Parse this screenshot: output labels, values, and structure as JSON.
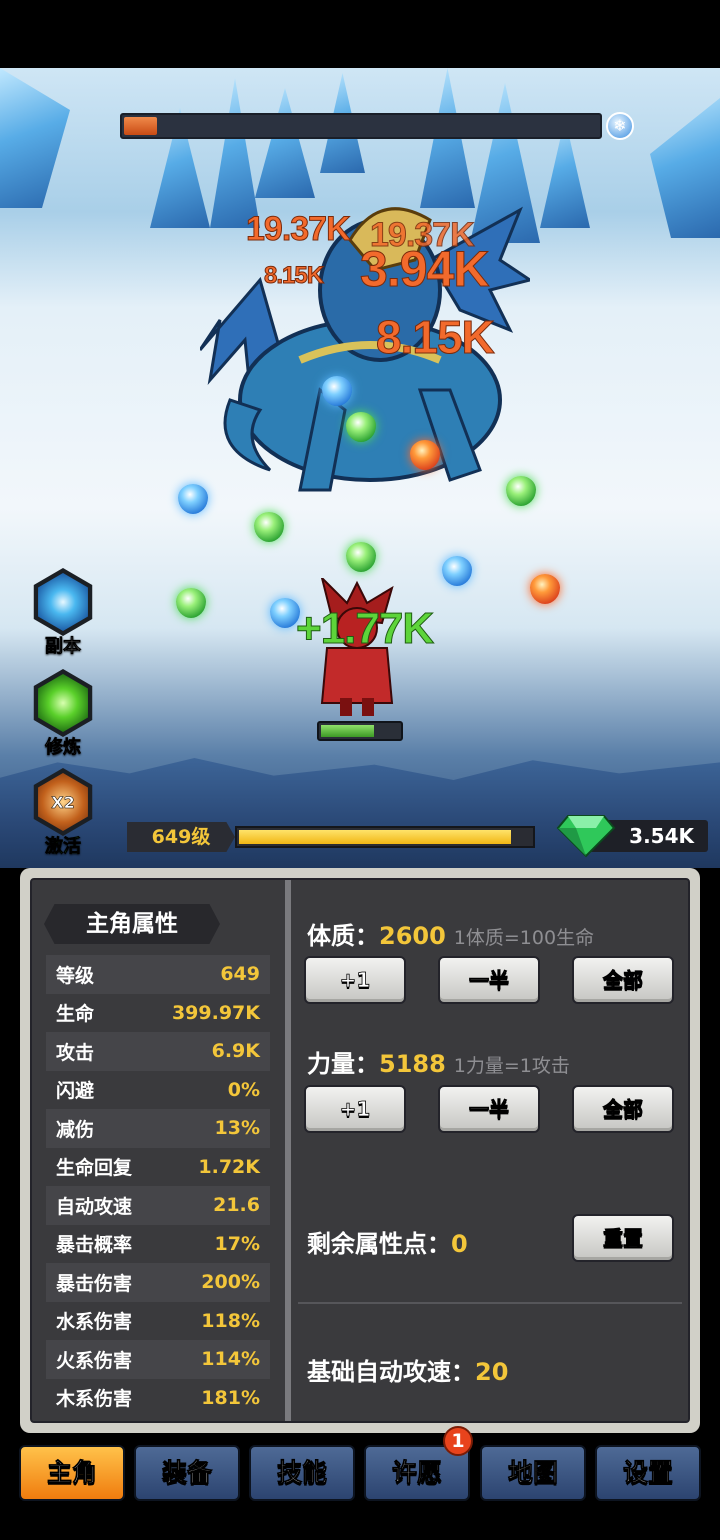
{
  "battle": {
    "boss_hp_fraction": 0.07,
    "boss_element_icon": "snowflake-icon",
    "damage_numbers": [
      "19.37K",
      "19.37K",
      "8.15K",
      "3.94K",
      "8.15K"
    ],
    "heal_number": "+1.77K",
    "hero_hp_fraction": 0.65
  },
  "side_buttons": {
    "dungeon": {
      "label": "副本",
      "icon": "vortex-icon"
    },
    "training": {
      "label": "修炼",
      "icon": "green-swirl-icon"
    },
    "activate": {
      "label": "激活",
      "badge": "X2",
      "icon": "x2-boost-icon",
      "label_color": "#4fe04a"
    }
  },
  "progress": {
    "level": "649级",
    "exp_fraction": 0.92,
    "gems": "3.54K",
    "gem_icon": "green-diamond-icon"
  },
  "stats": {
    "title": "主角属性",
    "rows": [
      {
        "name": "等级",
        "value": "649"
      },
      {
        "name": "生命",
        "value": "399.97K"
      },
      {
        "name": "攻击",
        "value": "6.9K"
      },
      {
        "name": "闪避",
        "value": "0%"
      },
      {
        "name": "减伤",
        "value": "13%"
      },
      {
        "name": "生命回复",
        "value": "1.72K"
      },
      {
        "name": "自动攻速",
        "value": "21.6"
      },
      {
        "name": "暴击概率",
        "value": "17%"
      },
      {
        "name": "暴击伤害",
        "value": "200%"
      },
      {
        "name": "水系伤害",
        "value": "118%"
      },
      {
        "name": "火系伤害",
        "value": "114%"
      },
      {
        "name": "木系伤害",
        "value": "181%"
      }
    ]
  },
  "attributes": {
    "constitution": {
      "label": "体质：",
      "value": "2600",
      "hint": "1体质=100生命"
    },
    "strength": {
      "label": "力量：",
      "value": "5188",
      "hint": "1力量=1攻击"
    },
    "buttons": {
      "plus_one": "+1",
      "half": "一半",
      "all": "全部"
    },
    "remaining": {
      "label": "剩余属性点：",
      "value": "0"
    },
    "reset_label": "重置",
    "base_speed": {
      "label": "基础自动攻速：",
      "value": "20"
    }
  },
  "tabs": [
    {
      "label": "主角",
      "active": true
    },
    {
      "label": "装备",
      "active": false
    },
    {
      "label": "技能",
      "active": false
    },
    {
      "label": "许愿",
      "active": false,
      "badge": "1"
    },
    {
      "label": "地图",
      "active": false
    },
    {
      "label": "设置",
      "active": false
    }
  ],
  "colors": {
    "accent_orange": "#f07c0e",
    "gold_text": "#f3c63a",
    "damage": "#f26a2c",
    "heal": "#5dd43a"
  }
}
